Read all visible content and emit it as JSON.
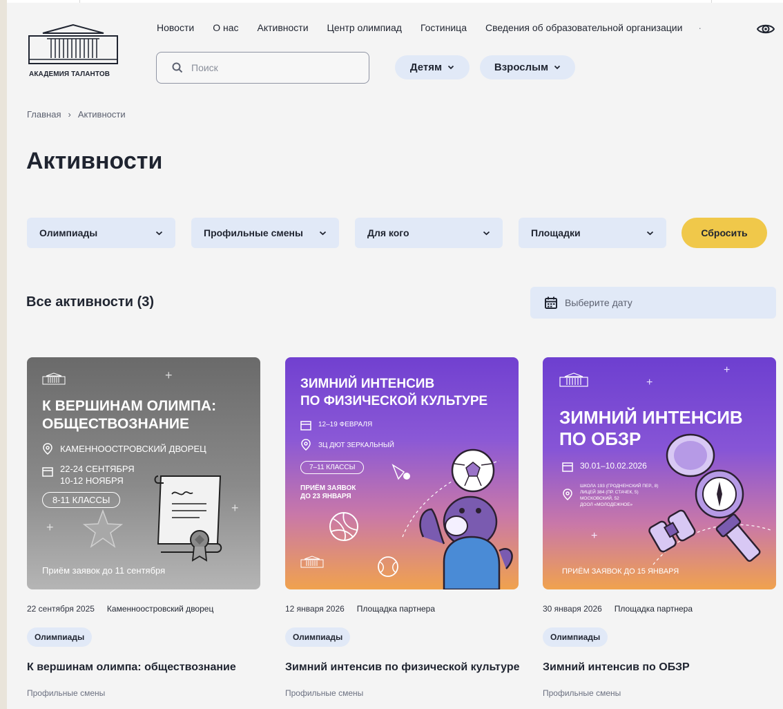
{
  "header": {
    "logo_text": "АКАДЕМИЯ ТАЛАНТОВ",
    "nav": [
      "Новости",
      "О нас",
      "Активности",
      "Центр олимпиад",
      "Гостиница",
      "Сведения об образовательной организации"
    ],
    "nav_dot": "·",
    "search_placeholder": "Поиск",
    "audience": [
      {
        "label": "Детям"
      },
      {
        "label": "Взрослым"
      }
    ]
  },
  "breadcrumb": {
    "home": "Главная",
    "sep": "›",
    "current": "Активности"
  },
  "page_title": "Активности",
  "filters": [
    "Олимпиады",
    "Профильные смены",
    "Для кого",
    "Площадки"
  ],
  "reset_label": "Сбросить",
  "list_title": "Все активности (3)",
  "date_placeholder": "Выберите дату",
  "colors": {
    "accent_yellow": "#f0c84a",
    "pill_blue": "#e1e9f7",
    "text": "#1f2430"
  },
  "cards": [
    {
      "poster": {
        "title_line1": "К ВЕРШИНАМ ОЛИМПА:",
        "title_line2": "ОБЩЕСТВОЗНАНИЕ",
        "place": "КАМЕННООСТРОВСКИЙ ДВОРЕЦ",
        "dates_line1": "22-24 СЕНТЯБРЯ",
        "dates_line2": "10-12 НОЯБРЯ",
        "grades": "8-11 КЛАССЫ",
        "deadline": "Приём заявок до 11 сентября"
      },
      "date": "22 сентября 2025",
      "place": "Каменноостровский дворец",
      "tag": "Олимпиады",
      "title": "К вершинам олимпа: обществознание",
      "category": "Профильные смены"
    },
    {
      "poster": {
        "title_line1": "ЗИМНИЙ ИНТЕНСИВ",
        "title_line2": "ПО ФИЗИЧЕСКОЙ КУЛЬТУРЕ",
        "dates": "12–19 ФЕВРАЛЯ",
        "place": "ЗЦ ДЮТ ЗЕРКАЛЬНЫЙ",
        "grades": "7–11 КЛАССЫ",
        "deadline_line1": "ПРИЁМ ЗАЯВОК",
        "deadline_line2": "ДО 23 ЯНВАРЯ"
      },
      "date": "12 января 2026",
      "place": "Площадка партнера",
      "tag": "Олимпиады",
      "title": "Зимний интенсив по физической культуре",
      "category": "Профильные смены"
    },
    {
      "poster": {
        "title_line1": "ЗИМНИЙ ИНТЕНСИВ",
        "title_line2": "ПО ОБЗР",
        "dates": "30.01–10.02.2026",
        "addr_line1": "ШКОЛА 193 (ГРОДНЕНСКИЙ ПЕР., 8)",
        "addr_line2": "ЛИЦЕЙ 384 (ПР. СТАЧЕК, 5)",
        "addr_line3": "МОСКОВСКИЙ, 52",
        "addr_line4": "ДООЛ «МОЛОДЕЖНОЕ»",
        "deadline": "ПРИЁМ ЗАЯВОК ДО 15 ЯНВАРЯ"
      },
      "date": "30 января 2026",
      "place": "Площадка партнера",
      "tag": "Олимпиады",
      "title": "Зимний интенсив по ОБЗР",
      "category": "Профильные смены"
    }
  ]
}
